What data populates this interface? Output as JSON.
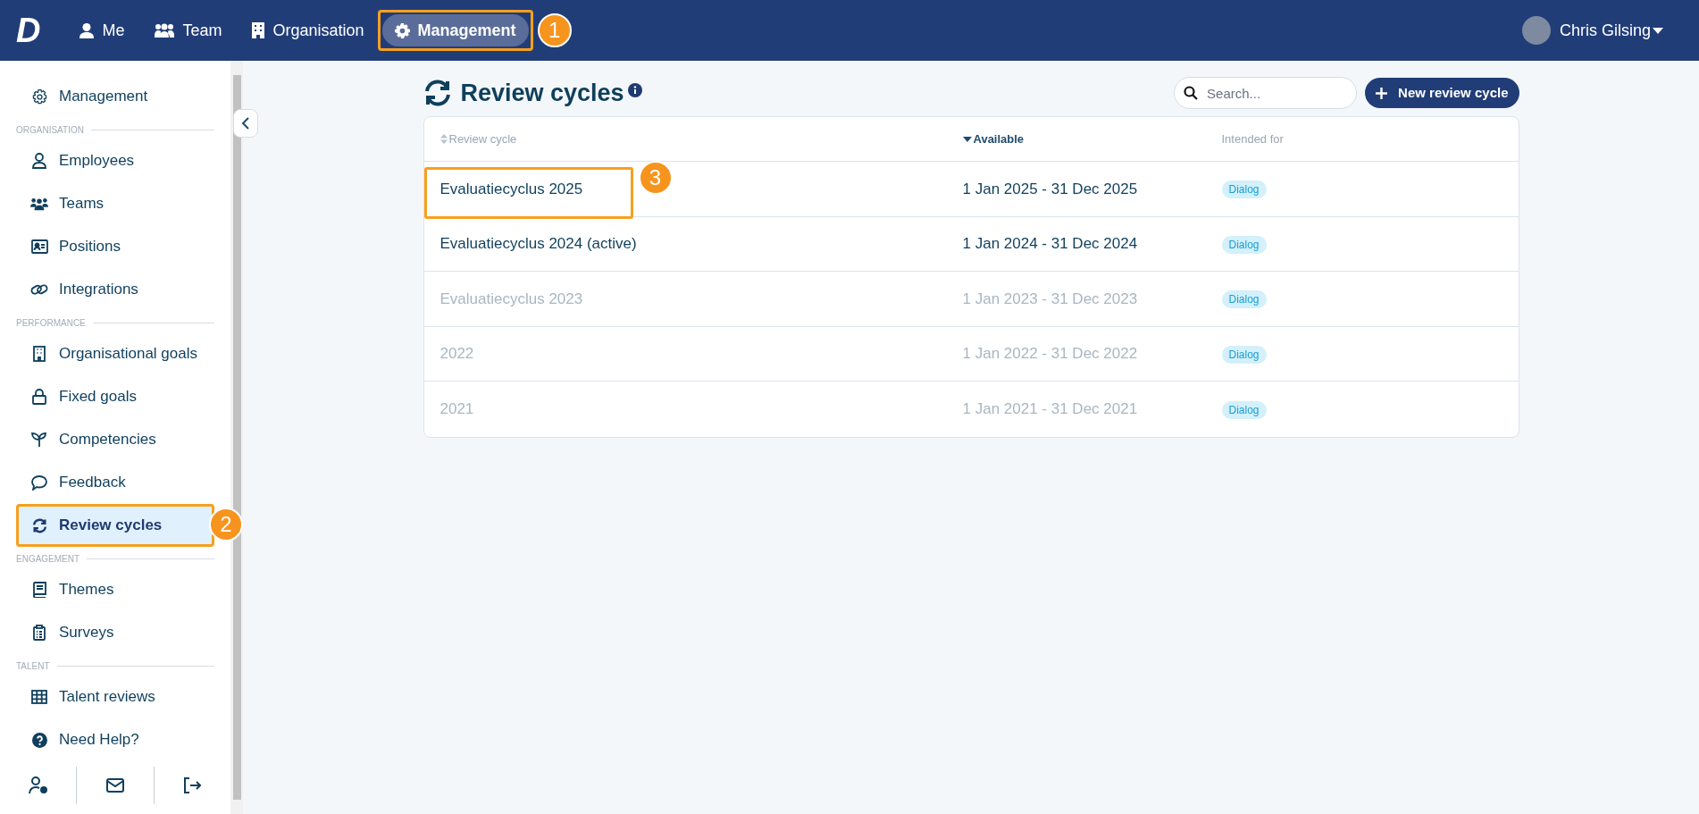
{
  "top_nav": {
    "logo": "D",
    "items": [
      {
        "label": "Me",
        "selected": false
      },
      {
        "label": "Team",
        "selected": false
      },
      {
        "label": "Organisation",
        "selected": false
      },
      {
        "label": "Management",
        "selected": true,
        "callout": "1"
      }
    ],
    "user": {
      "name": "Chris Gilsing"
    }
  },
  "sidebar": {
    "groups": [
      {
        "items": [
          {
            "label": "Management",
            "selected": false
          }
        ]
      },
      {
        "label": "ORGANISATION",
        "items": [
          {
            "label": "Employees",
            "selected": false
          },
          {
            "label": "Teams",
            "selected": false
          },
          {
            "label": "Positions",
            "selected": false
          },
          {
            "label": "Integrations",
            "selected": false
          }
        ]
      },
      {
        "label": "PERFORMANCE",
        "items": [
          {
            "label": "Organisational goals",
            "selected": false
          },
          {
            "label": "Fixed goals",
            "selected": false
          },
          {
            "label": "Competencies",
            "selected": false
          },
          {
            "label": "Feedback",
            "selected": false
          },
          {
            "label": "Review cycles",
            "selected": true,
            "callout": "2"
          }
        ]
      },
      {
        "label": "ENGAGEMENT",
        "items": [
          {
            "label": "Themes",
            "selected": false
          },
          {
            "label": "Surveys",
            "selected": false
          }
        ]
      },
      {
        "label": "TALENT",
        "items": [
          {
            "label": "Talent reviews",
            "selected": false
          }
        ]
      },
      {
        "items": [
          {
            "label": "Need Help?",
            "selected": false
          }
        ]
      }
    ]
  },
  "page": {
    "title": "Review cycles",
    "search": {
      "placeholder": "Search..."
    },
    "new_button": "New review cycle",
    "table": {
      "columns": [
        {
          "label": "Review cycle",
          "sortable": true,
          "sorted": false
        },
        {
          "label": "Available",
          "sortable": true,
          "sorted": true
        },
        {
          "label": "Intended for",
          "sortable": false,
          "sorted": false
        }
      ],
      "rows": [
        {
          "name": "Evaluatiecyclus 2025",
          "period": "1 Jan 2025 - 31 Dec 2025",
          "intended_for": "Dialog",
          "dimmed": false,
          "callout": "3"
        },
        {
          "name": "Evaluatiecyclus 2024 (active)",
          "period": "1 Jan 2024 - 31 Dec 2024",
          "intended_for": "Dialog",
          "dimmed": false
        },
        {
          "name": "Evaluatiecyclus 2023",
          "period": "1 Jan 2023 - 31 Dec 2023",
          "intended_for": "Dialog",
          "dimmed": true
        },
        {
          "name": "2022",
          "period": "1 Jan 2022 - 31 Dec 2022",
          "intended_for": "Dialog",
          "dimmed": true
        },
        {
          "name": "2021",
          "period": "1 Jan 2021 - 31 Dec 2021",
          "intended_for": "Dialog",
          "dimmed": true
        }
      ]
    }
  }
}
